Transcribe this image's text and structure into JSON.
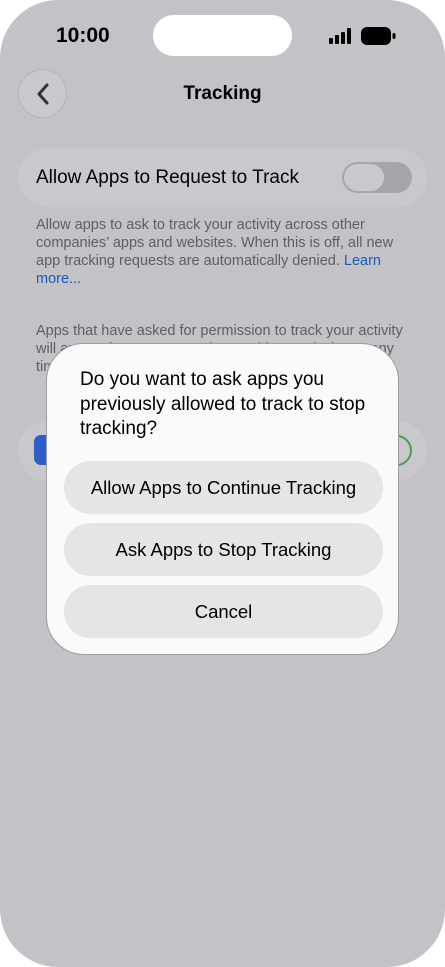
{
  "status_bar": {
    "time": "10:00",
    "signal_icon": "cellular-signal-icon",
    "battery_icon": "battery-full-icon"
  },
  "nav": {
    "back_icon": "chevron-left-icon",
    "title": "Tracking"
  },
  "settings": {
    "allow_request_label": "Allow Apps to Request to Track",
    "allow_request_enabled": false,
    "description": "Allow apps to ask to track your activity across other companies’ apps and websites. When this is off, all new app tracking requests are automatically denied.",
    "learn_more": "Learn more...",
    "apps_section_text": "Apps that have asked for permission to track your activity will appear here. You can change this permission at any time."
  },
  "dialog": {
    "message": "Do you want to ask apps you previously allowed to track to stop tracking?",
    "buttons": {
      "continue": "Allow Apps to Continue Tracking",
      "stop": "Ask Apps to Stop Tracking",
      "cancel": "Cancel"
    }
  },
  "colors": {
    "overlay_background": "#c3c2c7",
    "dialog_background": "#fafafa",
    "button_background": "#e5e5e5",
    "link": "#1c5bb5"
  }
}
